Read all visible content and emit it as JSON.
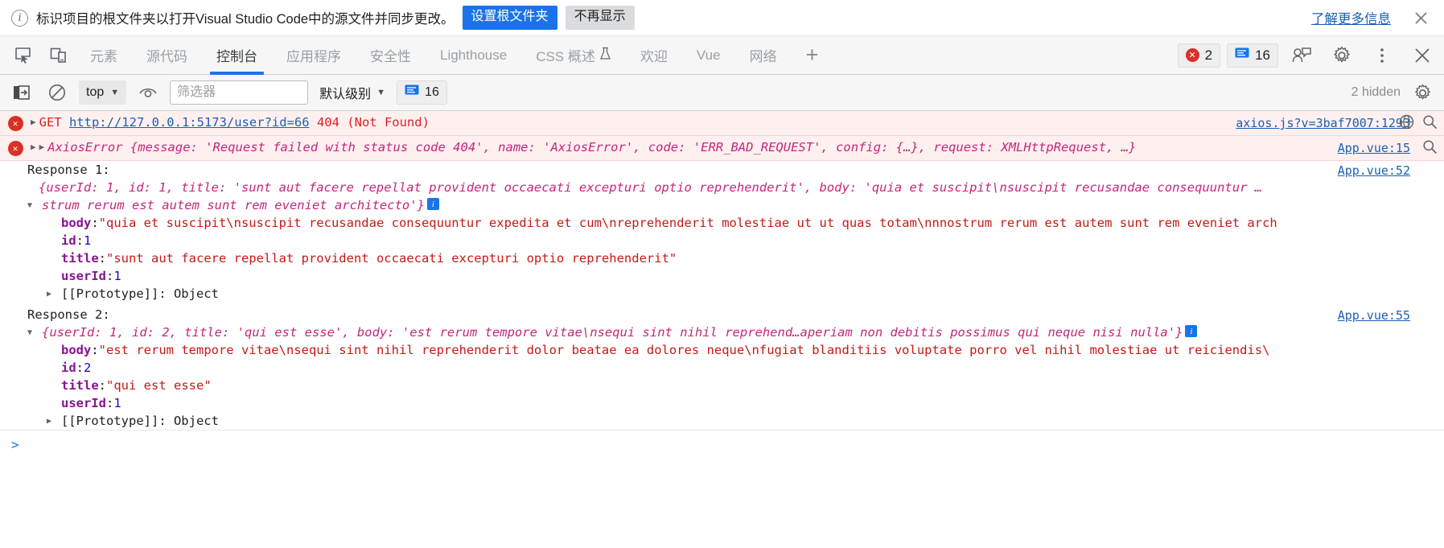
{
  "banner": {
    "icon": "info-circle-icon",
    "text": "标识项目的根文件夹以打开Visual Studio Code中的源文件并同步更改。",
    "primary_button": "设置根文件夹",
    "secondary_button": "不再显示",
    "learn_more": "了解更多信息",
    "close_icon": "close-icon"
  },
  "tabbar": {
    "inspect_icon": "inspect-element-icon",
    "device_icon": "device-toolbar-icon",
    "tabs": [
      {
        "label": "元素",
        "selected": false
      },
      {
        "label": "源代码",
        "selected": false
      },
      {
        "label": "控制台",
        "selected": true
      },
      {
        "label": "应用程序",
        "selected": false
      },
      {
        "label": "安全性",
        "selected": false
      },
      {
        "label": "Lighthouse",
        "selected": false
      },
      {
        "label": "CSS 概述",
        "selected": false,
        "flask": "⚗"
      },
      {
        "label": "欢迎",
        "selected": false
      },
      {
        "label": "Vue",
        "selected": false
      },
      {
        "label": "网络",
        "selected": false
      }
    ],
    "add_tab": "+",
    "error_badge": {
      "icon": "error-circle-icon",
      "count": "2"
    },
    "message_badge": {
      "icon": "message-icon",
      "count": "16"
    },
    "cursor_icon": "user-feedback-icon",
    "settings_icon": "gear-icon",
    "more_icon": "more-vertical-icon",
    "close_icon": "close-icon"
  },
  "filterbar": {
    "clear_console_icon": "clear-console-icon",
    "no_entry_icon": "no-entry-icon",
    "context": "top",
    "eye_icon": "live-expression-icon",
    "filter_placeholder": "筛选器",
    "filter_value": "",
    "level": "默认级别",
    "issues": {
      "icon": "message-icon",
      "count": "16"
    },
    "hidden_text": "2 hidden",
    "settings_icon": "gear-icon"
  },
  "console": {
    "rows": [
      {
        "kind": "error",
        "gutter": "error-circle-icon",
        "arrow": "▶",
        "method": "GET",
        "url": "http://127.0.0.1:5173/user?id=66",
        "status": "404",
        "status_text": "(Not Found)",
        "source": "axios.js?v=3baf7007:1293",
        "tools": [
          "network-icon",
          "search-icon"
        ]
      },
      {
        "kind": "error",
        "gutter": "error-circle-icon",
        "arrow": "▶",
        "arrow2": "▶",
        "text": "AxiosError {message: 'Request failed with status code 404', name: 'AxiosError', code: 'ERR_BAD_REQUEST', config: {…}, request: XMLHttpRequest, …}",
        "source": "App.vue:15",
        "tools": [
          "search-icon"
        ]
      }
    ],
    "blocks": [
      {
        "label": "Response 1:",
        "source": "App.vue:52",
        "preview_line1": "{userId: 1, id: 1, title: 'sunt aut facere repellat provident occaecati excepturi optio reprehenderit', body: 'quia et suscipit\\nsuscipit recusandae consequuntur …",
        "preview_line2": "strum rerum est autem sunt rem eveniet architecto'}",
        "info_badge": "i",
        "props": [
          {
            "key": "body",
            "value": "\"quia et suscipit\\nsuscipit recusandae consequuntur expedita et cum\\nreprehenderit molestiae ut ut quas totam\\nnnostrum rerum est autem sunt rem eveniet arch",
            "type": "string"
          },
          {
            "key": "id",
            "value": "1",
            "type": "number"
          },
          {
            "key": "title",
            "value": "\"sunt aut facere repellat provident occaecati excepturi optio reprehenderit\"",
            "type": "string"
          },
          {
            "key": "userId",
            "value": "1",
            "type": "number"
          }
        ],
        "prototype": "[[Prototype]]: Object"
      },
      {
        "label": "Response 2:",
        "source": "App.vue:55",
        "preview_line1": "{userId: 1, id: 2, title: 'qui est esse', body: 'est rerum tempore vitae\\nsequi sint nihil reprehend…aperiam non debitis possimus qui neque nisi nulla'}",
        "preview_line2": "",
        "info_badge": "i",
        "props": [
          {
            "key": "body",
            "value": "\"est rerum tempore vitae\\nsequi sint nihil reprehenderit dolor beatae ea dolores neque\\nfugiat blanditiis voluptate porro vel nihil molestiae ut reiciendis\\",
            "type": "string"
          },
          {
            "key": "id",
            "value": "2",
            "type": "number"
          },
          {
            "key": "title",
            "value": "\"qui est esse\"",
            "type": "string"
          },
          {
            "key": "userId",
            "value": "1",
            "type": "number"
          }
        ],
        "prototype": "[[Prototype]]: Object"
      }
    ],
    "prompt": ">"
  },
  "colors": {
    "accent": "#1a73e8",
    "error": "#d93025",
    "error_bg": "#fff0f0",
    "link": "#1a5fb4",
    "object": "#c5257d",
    "key": "#881391",
    "string": "#c41a16",
    "number": "#1c00cf"
  }
}
